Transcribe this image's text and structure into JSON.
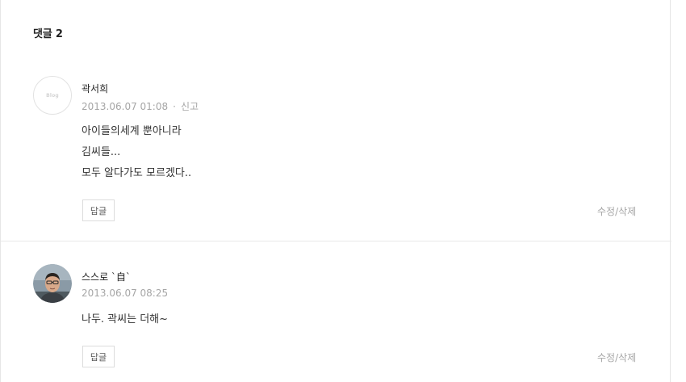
{
  "comments_section": {
    "title": "댓글 2"
  },
  "comments": [
    {
      "author": "곽서희",
      "avatar_text": "Blog",
      "date": "2013.06.07 01:08",
      "separator": "·",
      "report_label": "신고",
      "lines": [
        "아이들의세계 뿐아니라",
        "김씨들...",
        "모두 알다가도 모르겠다.."
      ],
      "reply_label": "답글",
      "edit_delete_label": "수정/삭제"
    },
    {
      "author": "스스로 `自`",
      "avatar_icon": "user-photo-icon",
      "date": "2013.06.07 08:25",
      "lines": [
        "나두. 곽씨는 더해~"
      ],
      "reply_label": "답글",
      "edit_delete_label": "수정/삭제"
    }
  ]
}
